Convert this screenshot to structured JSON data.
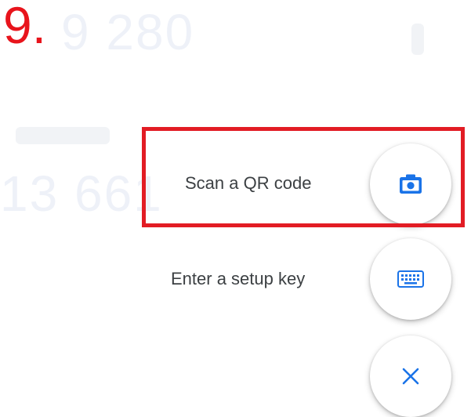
{
  "background": {
    "code_top": "9 280",
    "code_middle": "13 661"
  },
  "annotation": {
    "step_number": "9.",
    "highlight_color": "#e21c24"
  },
  "menu": {
    "scan_qr_label": "Scan a QR code",
    "scan_qr_icon": "camera-icon",
    "setup_key_label": "Enter a setup key",
    "setup_key_icon": "keyboard-icon",
    "close_icon": "close-icon"
  },
  "colors": {
    "accent": "#1a73e8",
    "label_text": "#3c4043"
  }
}
